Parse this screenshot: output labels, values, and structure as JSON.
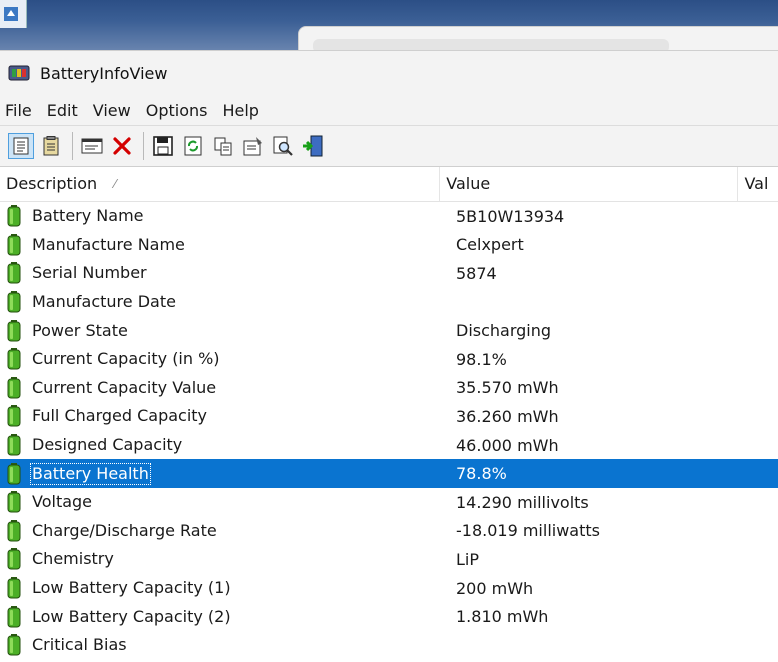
{
  "window": {
    "title": "BatteryInfoView"
  },
  "menu": [
    "File",
    "Edit",
    "View",
    "Options",
    "Help"
  ],
  "toolbar": [
    {
      "icon": "html-report-icon"
    },
    {
      "icon": "report-selected-icon"
    },
    {
      "icon": "properties-window-icon"
    },
    {
      "icon": "delete-icon"
    },
    {
      "icon": "save-icon"
    },
    {
      "icon": "refresh-icon"
    },
    {
      "icon": "copy-icon"
    },
    {
      "icon": "options-icon"
    },
    {
      "icon": "find-icon"
    },
    {
      "icon": "exit-icon"
    }
  ],
  "columns": {
    "description": "Description",
    "value": "Value",
    "value2": "Val"
  },
  "rows": [
    {
      "label": "Battery Name",
      "value": "5B10W13934"
    },
    {
      "label": "Manufacture Name",
      "value": "Celxpert"
    },
    {
      "label": "Serial Number",
      "value": " 5874"
    },
    {
      "label": "Manufacture Date",
      "value": ""
    },
    {
      "label": "Power State",
      "value": "Discharging"
    },
    {
      "label": "Current Capacity (in %)",
      "value": "98.1%"
    },
    {
      "label": "Current Capacity Value",
      "value": "35.570 mWh"
    },
    {
      "label": "Full Charged Capacity",
      "value": "36.260 mWh"
    },
    {
      "label": "Designed Capacity",
      "value": "46.000 mWh"
    },
    {
      "label": "Battery Health",
      "value": "78.8%",
      "selected": true
    },
    {
      "label": "Voltage",
      "value": "14.290 millivolts"
    },
    {
      "label": "Charge/Discharge Rate",
      "value": "-18.019 milliwatts"
    },
    {
      "label": "Chemistry",
      "value": "LiP"
    },
    {
      "label": "Low Battery Capacity (1)",
      "value": "200 mWh"
    },
    {
      "label": "Low Battery Capacity (2)",
      "value": "1.810 mWh"
    },
    {
      "label": "Critical Bias",
      "value": ""
    }
  ],
  "colors": {
    "selection": "#0a74d0",
    "battery_green": "#3f8f1c"
  }
}
